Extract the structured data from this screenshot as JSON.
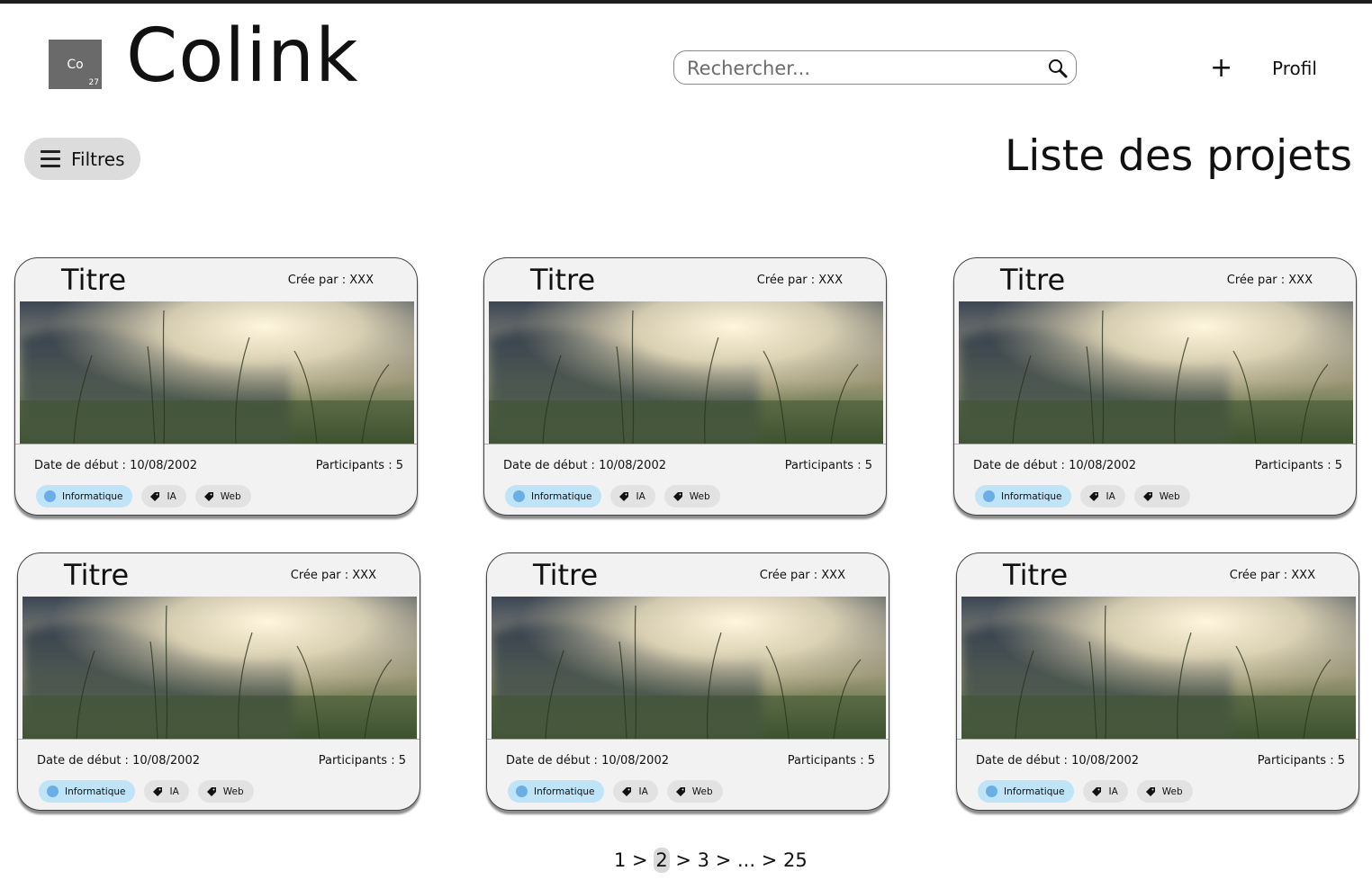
{
  "header": {
    "logo": {
      "symbol": "Co",
      "number": "27"
    },
    "brand": "Colink",
    "search": {
      "placeholder": "Rechercher...",
      "value": ""
    },
    "add_label": "+",
    "profile_label": "Profil"
  },
  "toolbar": {
    "filter_label": "Filtres",
    "page_title": "Liste des projets"
  },
  "projects": [
    {
      "title": "Titre",
      "author": "Crée par : XXX",
      "start_date": "Date de début : 10/08/2002",
      "participants": "Participants : 5",
      "tags": [
        "Informatique",
        "IA",
        "Web"
      ]
    },
    {
      "title": "Titre",
      "author": "Crée par : XXX",
      "start_date": "Date de début : 10/08/2002",
      "participants": "Participants : 5",
      "tags": [
        "Informatique",
        "IA",
        "Web"
      ]
    },
    {
      "title": "Titre",
      "author": "Crée par : XXX",
      "start_date": "Date de début : 10/08/2002",
      "participants": "Participants : 5",
      "tags": [
        "Informatique",
        "IA",
        "Web"
      ]
    },
    {
      "title": "Titre",
      "author": "Crée par : XXX",
      "start_date": "Date de début : 10/08/2002",
      "participants": "Participants : 5",
      "tags": [
        "Informatique",
        "IA",
        "Web"
      ]
    },
    {
      "title": "Titre",
      "author": "Crée par : XXX",
      "start_date": "Date de début : 10/08/2002",
      "participants": "Participants : 5",
      "tags": [
        "Informatique",
        "IA",
        "Web"
      ]
    },
    {
      "title": "Titre",
      "author": "Crée par : XXX",
      "start_date": "Date de début : 10/08/2002",
      "participants": "Participants : 5",
      "tags": [
        "Informatique",
        "IA",
        "Web"
      ]
    }
  ],
  "pagination": {
    "items": [
      "1",
      "2",
      "3",
      "...",
      "25"
    ],
    "separator": " > ",
    "current": "2"
  },
  "colors": {
    "primary_tag": "#bfe3f7",
    "primary_dot": "#6aaee6",
    "tag": "#e2e2e2",
    "filter_button": "#dcdcdc"
  },
  "icons": {
    "search": "magnifier-icon",
    "filter": "hamburger-icon",
    "tag": "tag-icon",
    "category": "circle-dot-icon"
  }
}
